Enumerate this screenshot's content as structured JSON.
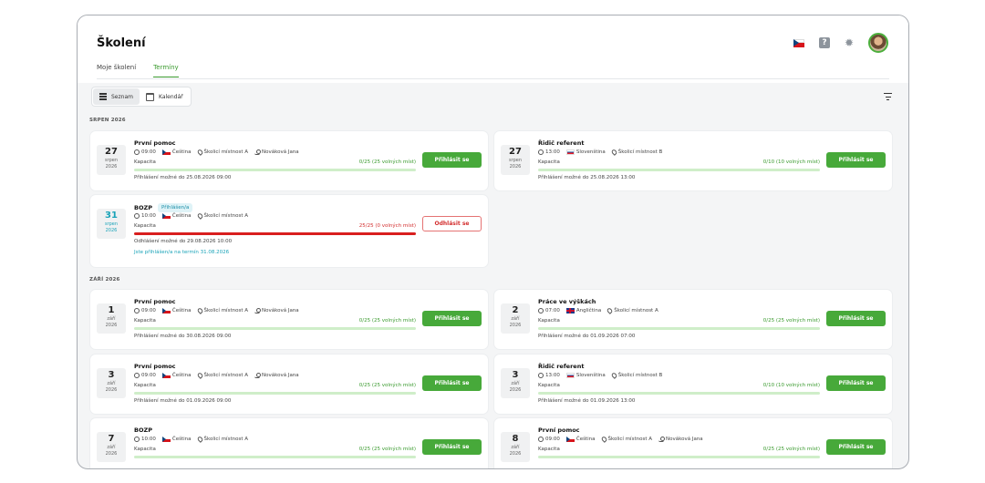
{
  "header": {
    "title": "Školení",
    "tabs": [
      {
        "label": "Moje školení"
      },
      {
        "label": "Termíny"
      }
    ],
    "icons": [
      "cz-flag-icon",
      "help-icon",
      "gear-icon",
      "avatar"
    ]
  },
  "view": {
    "list_label": "Seznam",
    "calendar_label": "Kalendář"
  },
  "colors": {
    "accent": "#47a93a",
    "danger": "#d32f2f",
    "teal": "#1aa3b8"
  },
  "sections": [
    {
      "label": "SRPEN 2026",
      "cards": [
        {
          "day": "27",
          "month": "srpen",
          "year": "2026",
          "title": "První pomoc",
          "time": "09:00",
          "lang": "Čeština",
          "flag": "cz",
          "room": "Školicí místnost A",
          "person": "Nováková Jana",
          "cap_label": "Kapacita",
          "capacity": "0/25 (25 volných míst)",
          "fill": 0,
          "note": "Přihlášení možné do 25.08.2026 09:00",
          "button": "Přihlásit se"
        },
        {
          "day": "27",
          "month": "srpen",
          "year": "2026",
          "title": "Řidič referent",
          "time": "13:00",
          "lang": "Slovenština",
          "flag": "sk",
          "room": "Školicí místnost B",
          "person": "",
          "cap_label": "Kapacita",
          "capacity": "0/10 (10 volných míst)",
          "fill": 0,
          "note": "Přihlášení možné do 25.08.2026 13:00",
          "button": "Přihlásit se"
        },
        {
          "day": "31",
          "month": "srpen",
          "year": "2026",
          "title": "BOZP",
          "badge": "Přihlášen/a",
          "time": "10:00",
          "lang": "Čeština",
          "flag": "cz",
          "room": "Školicí místnost A",
          "person": "",
          "cap_label": "Kapacita",
          "capacity": "25/25 (0 volných míst)",
          "fill": 1,
          "note": "Odhlášení možné do 29.08.2026 10:00",
          "note2": "Jste přihlášen/a na termín 31.08.2026",
          "button": "Odhlásit se"
        }
      ]
    },
    {
      "label": "ZÁŘÍ 2026",
      "cards": [
        {
          "day": "1",
          "month": "září",
          "year": "2026",
          "title": "První pomoc",
          "time": "09:00",
          "lang": "Čeština",
          "flag": "cz",
          "room": "Školicí místnost A",
          "person": "Nováková Jana",
          "cap_label": "Kapacita",
          "capacity": "0/25 (25 volných míst)",
          "fill": 0,
          "note": "Přihlášení možné do 30.08.2026 09:00",
          "button": "Přihlásit se"
        },
        {
          "day": "2",
          "month": "září",
          "year": "2026",
          "title": "Práce ve výškách",
          "time": "07:00",
          "lang": "Angličtina",
          "flag": "gb",
          "room": "Školicí místnost A",
          "person": "",
          "cap_label": "Kapacita",
          "capacity": "0/25 (25 volných míst)",
          "fill": 0,
          "note": "Přihlášení možné do 01.09.2026 07:00",
          "button": "Přihlásit se"
        },
        {
          "day": "3",
          "month": "září",
          "year": "2026",
          "title": "První pomoc",
          "time": "09:00",
          "lang": "Čeština",
          "flag": "cz",
          "room": "Školicí místnost A",
          "person": "Nováková Jana",
          "cap_label": "Kapacita",
          "capacity": "0/25 (25 volných míst)",
          "fill": 0,
          "note": "Přihlášení možné do 01.09.2026 09:00",
          "button": "Přihlásit se"
        },
        {
          "day": "3",
          "month": "září",
          "year": "2026",
          "title": "Řidič referent",
          "time": "13:00",
          "lang": "Slovenština",
          "flag": "sk",
          "room": "Školicí místnost B",
          "person": "",
          "cap_label": "Kapacita",
          "capacity": "0/10 (10 volných míst)",
          "fill": 0,
          "note": "Přihlášení možné do 01.09.2026 13:00",
          "button": "Přihlásit se"
        },
        {
          "day": "7",
          "month": "září",
          "year": "2026",
          "title": "BOZP",
          "time": "10:00",
          "lang": "Čeština",
          "flag": "cz",
          "room": "Školicí místnost A",
          "person": "",
          "cap_label": "Kapacita",
          "capacity": "0/25 (25 volných míst)",
          "fill": 0,
          "note": "",
          "button": "Přihlásit se"
        },
        {
          "day": "8",
          "month": "září",
          "year": "2026",
          "title": "První pomoc",
          "time": "09:00",
          "lang": "Čeština",
          "flag": "cz",
          "room": "Školicí místnost A",
          "person": "Nováková Jana",
          "cap_label": "Kapacita",
          "capacity": "0/25 (25 volných míst)",
          "fill": 0,
          "note": "",
          "button": "Přihlásit se"
        }
      ]
    }
  ]
}
